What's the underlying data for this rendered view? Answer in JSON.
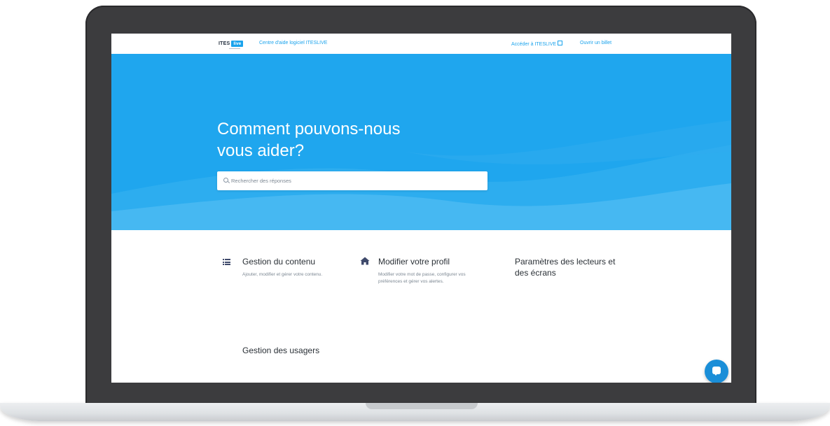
{
  "header": {
    "logo_text": "ITES",
    "logo_badge": "live",
    "site_title": "Centre d'aide logiciel ITESLIVE",
    "access_link": "Accéder à ITESLIVE",
    "ticket_link": "Ouvrir un billet"
  },
  "hero": {
    "title_line1": "Comment pouvons-nous",
    "title_line2": "vous aider?",
    "search_placeholder": "Rechercher des réponses"
  },
  "categories": [
    {
      "icon": "list-icon",
      "title": "Gestion du contenu",
      "description": "Ajouter, modifier et gérer votre contenu."
    },
    {
      "icon": "home-icon",
      "title": "Modifier votre profil",
      "description": "Modifier votre mot de passe, configurer vos préférences et gérer vos alertes."
    },
    {
      "icon": "",
      "title": "Paramètres des lecteurs et des écrans",
      "description": ""
    },
    {
      "icon": "",
      "title": "Gestion des usagers",
      "description": ""
    }
  ],
  "chat": {
    "icon": "chat-bubble-icon"
  },
  "colors": {
    "accent": "#1fa6ee",
    "frame": "#3c3c3e",
    "text": "#2a3036"
  }
}
